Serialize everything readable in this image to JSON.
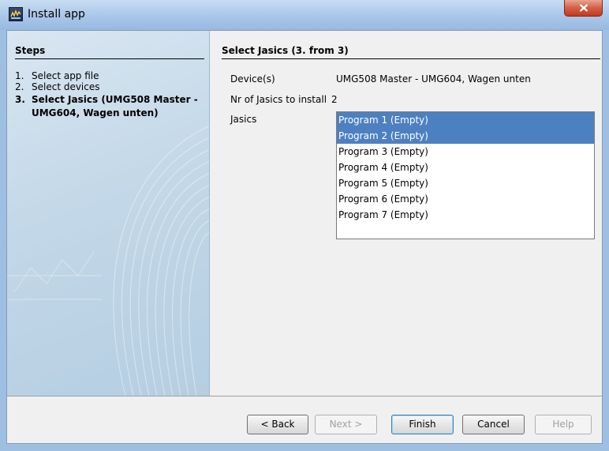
{
  "window": {
    "title": "Install app",
    "icon": "app-logo-icon",
    "close_glyph": "x",
    "title_color": "#000000",
    "close_button_color": "#c94f35"
  },
  "steps": {
    "title": "Steps",
    "items": [
      {
        "number": "1.",
        "label": "Select app file",
        "current": false
      },
      {
        "number": "2.",
        "label": "Select devices",
        "current": false
      },
      {
        "number": "3.",
        "label": "Select Jasics (UMG508 Master - UMG604, Wagen unten)",
        "current": true
      }
    ]
  },
  "content": {
    "title": "Select Jasics (3. from 3)",
    "device_label": "Device(s)",
    "device_value": "UMG508 Master - UMG604, Wagen unten",
    "nr_label": "Nr of Jasics to install",
    "nr_value": "2",
    "jasics_label": "Jasics",
    "jasics": [
      {
        "label": "Program 1 (Empty)",
        "selected": true
      },
      {
        "label": "Program 2 (Empty)",
        "selected": true
      },
      {
        "label": "Program 3 (Empty)",
        "selected": false
      },
      {
        "label": "Program 4 (Empty)",
        "selected": false
      },
      {
        "label": "Program 5 (Empty)",
        "selected": false
      },
      {
        "label": "Program 6 (Empty)",
        "selected": false
      },
      {
        "label": "Program 7 (Empty)",
        "selected": false
      }
    ],
    "selection_color": "#4d80c0"
  },
  "buttons": {
    "back": "< Back",
    "next": "Next >",
    "finish": "Finish",
    "cancel": "Cancel",
    "help": "Help"
  }
}
